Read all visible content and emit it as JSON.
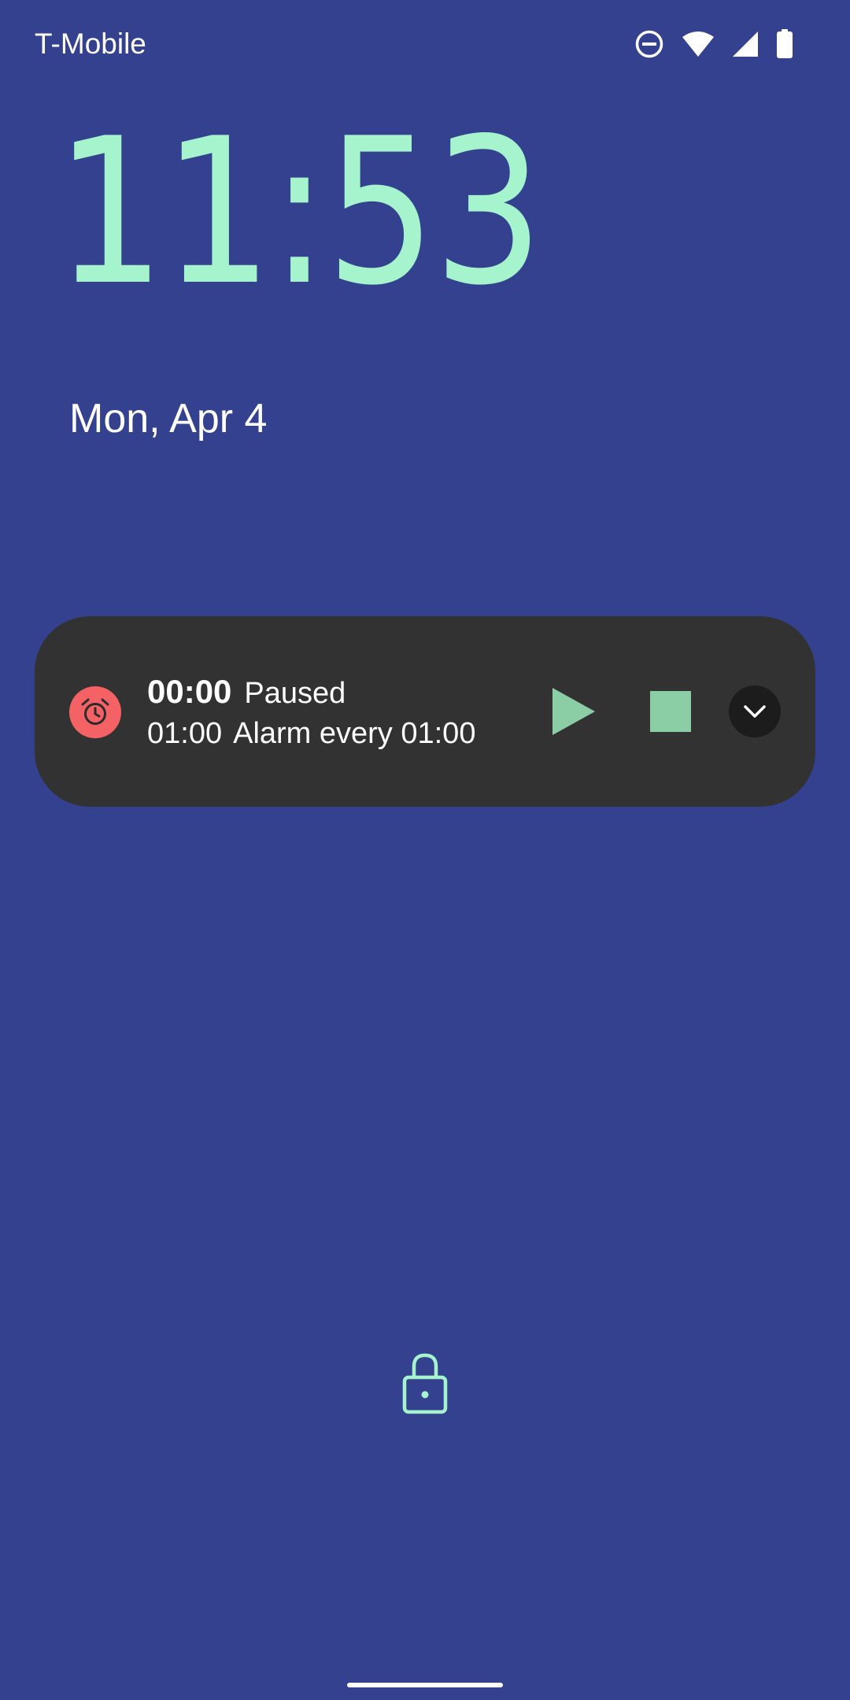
{
  "status_bar": {
    "carrier": "T-Mobile",
    "icons": [
      "do-not-disturb-icon",
      "wifi-icon",
      "cell-signal-icon",
      "battery-icon"
    ]
  },
  "lockscreen": {
    "time": "11:53",
    "date": "Mon, Apr 4"
  },
  "notification": {
    "app_icon": "alarm-clock-icon",
    "timer_value": "00:00",
    "timer_status": "Paused",
    "interval": "01:00",
    "description": "Alarm every 01:00",
    "actions": [
      "play-icon",
      "stop-icon",
      "expand-icon"
    ]
  },
  "colors": {
    "background": "#33418E",
    "clock": "#A6F4CD",
    "notification_bg": "#323232",
    "app_icon_bg": "#F46266",
    "action_accent": "#8BCDA5",
    "lock_icon": "#A6F4CD"
  }
}
